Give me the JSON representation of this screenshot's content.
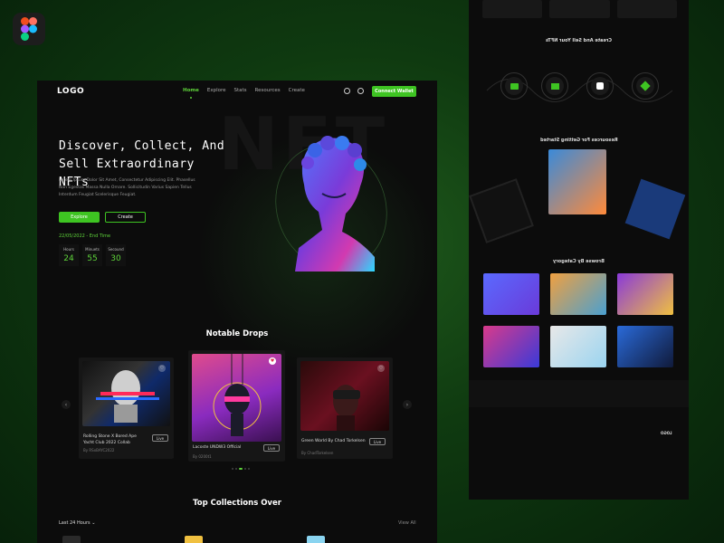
{
  "app": {
    "tool_badge": "figma-logo"
  },
  "nav": {
    "logo": "LOGO",
    "links": [
      "Home",
      "Explore",
      "Stats",
      "Resources",
      "Create"
    ],
    "connect_label": "Connect Wallet"
  },
  "hero": {
    "title": "Discover, Collect, And Sell Extraordinary NFTs",
    "description": "Lorem Ipsum Dolor Sit Amet, Consectetur Adipiscing Elit. Phasellus Non Egestas Massa Nulla Ornare. Sollicitudin Varius Sapien Tellus Interdum Feugiat Scelerisque Feugiat.",
    "explore_label": "Explore",
    "create_label": "Create",
    "end_time": "22/05/2022 - End Time",
    "countdown": [
      {
        "label": "Hours",
        "value": "24"
      },
      {
        "label": "Minuets",
        "value": "55"
      },
      {
        "label": "Secound",
        "value": "30"
      }
    ]
  },
  "notable": {
    "title": "Notable Drops",
    "cards": [
      {
        "title": "Rolling Stone X Bored Ape Yacht Club 2022 Collab",
        "by": "By RSxBAYC2022",
        "live": "Live"
      },
      {
        "title": "Lacoste UNDW3 Official",
        "by": "By 0200t1",
        "live": "Live"
      },
      {
        "title": "Green World By Chad Torkelsen",
        "by": "By ChadTorkelsen",
        "live": "Live"
      }
    ]
  },
  "top": {
    "title": "Top Collections Over",
    "filter": "Last 24 Hours",
    "view_all": "View All"
  },
  "right_preview": {
    "create_sell": "Create And Sell Your NFTs",
    "resources": "Resources For Getting Started",
    "browse": "Browse By Category",
    "footer_logo": "LOGO"
  },
  "colors": {
    "accent": "#3ec422",
    "accent_text": "#5ed33a",
    "card_bg": "#0c0c0c",
    "page_bg": "#0f3a10"
  }
}
